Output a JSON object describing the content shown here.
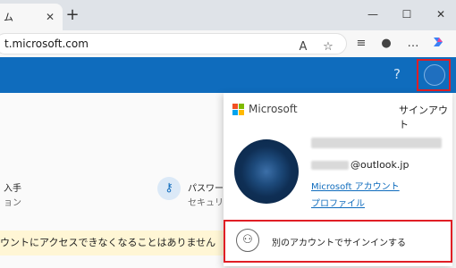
{
  "browser": {
    "tab_title": "ム",
    "tab_close": "✕",
    "new_tab": "+",
    "url": "t.microsoft.com",
    "window_minimize": "—",
    "window_maximize": "☐",
    "window_close": "✕",
    "toolbar_icons": [
      "read-aloud-icon",
      "favorite-star-icon",
      "favorites-icon",
      "profile-icon",
      "more-icon",
      "copilot-icon"
    ]
  },
  "header": {
    "help": "?"
  },
  "content": {
    "item1_title": "入手",
    "item1_sub": "ョン",
    "item2_title": "パスワー",
    "item2_sub": "セキュリ",
    "notice": "ウントにアクセスできなくなることはありません"
  },
  "flyout": {
    "brand": "Microsoft",
    "sign_out": "サインアウト",
    "email_domain": "@outlook.jp",
    "account_link": "Microsoft アカウント",
    "profile_link": "プロファイル",
    "other_account": "別のアカウントでサインインする"
  },
  "colors": {
    "header": "#0f6cbd",
    "highlight": "#e01e25",
    "ms_red": "#f25022",
    "ms_green": "#7fba00",
    "ms_blue": "#00a4ef",
    "ms_yellow": "#ffb900"
  }
}
